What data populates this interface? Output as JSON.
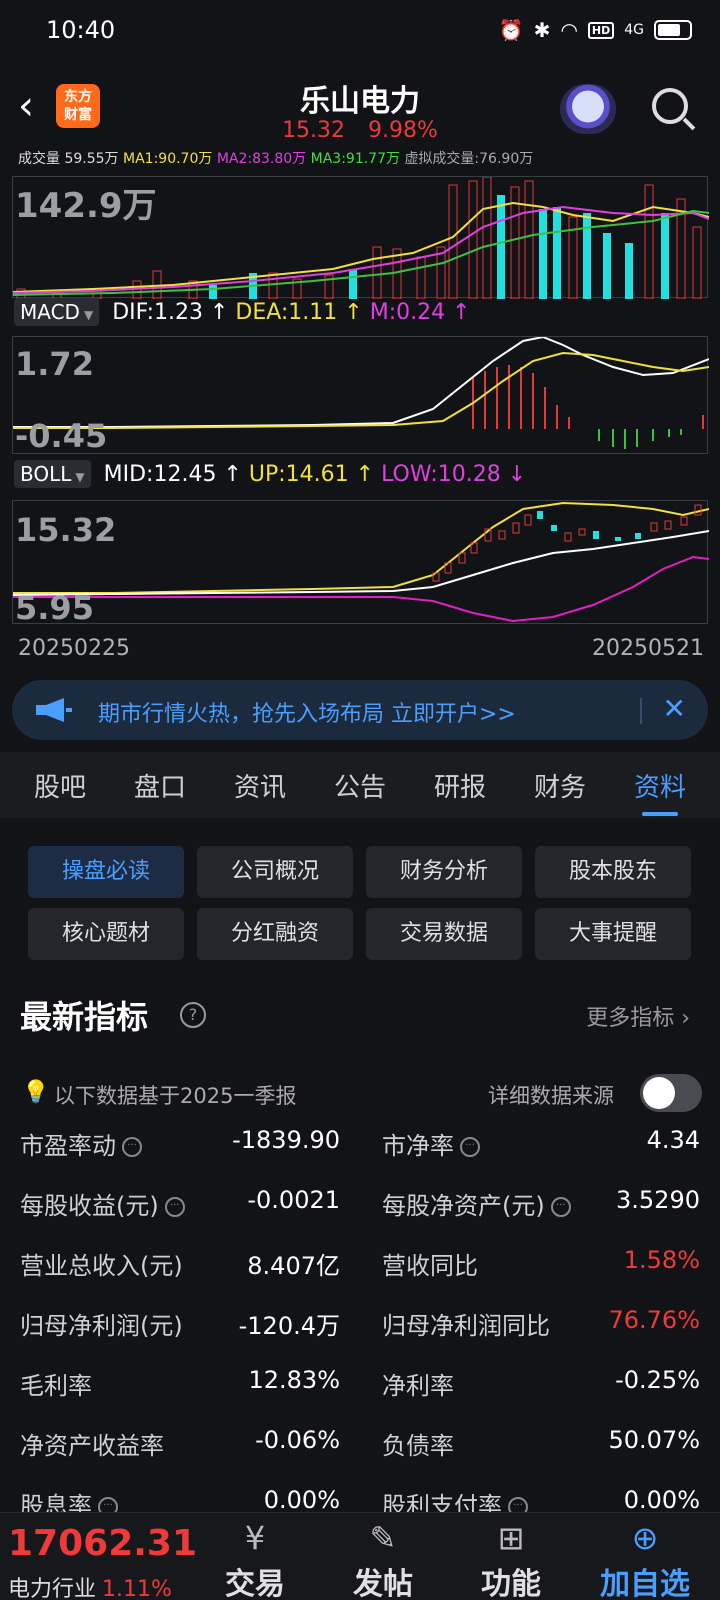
{
  "status_bar": {
    "time": "10:40",
    "network": "4G"
  },
  "header": {
    "back_icon": "chevron-left-icon",
    "logo_line1": "东方",
    "logo_line2": "财富",
    "title": "乐山电力",
    "price": "15.32",
    "change_pct": "9.98%",
    "colors": {
      "up": "#f03a3a",
      "accent": "#4a9eff"
    }
  },
  "volume_legend": {
    "label": "成交量",
    "vol": "59.55万",
    "ma1": "MA1:90.70万",
    "ma2": "MA2:83.80万",
    "ma3": "MA3:91.77万",
    "virtual": "虚拟成交量:76.90万",
    "axis_max": "142.9万"
  },
  "macd": {
    "tag": "MACD",
    "dif": "DIF:1.23",
    "dea": "DEA:1.11",
    "m": "M:0.24",
    "axis_top": "1.72",
    "axis_bottom": "-0.45"
  },
  "boll": {
    "tag": "BOLL",
    "mid": "MID:12.45",
    "up": "UP:14.61",
    "low": "LOW:10.28",
    "axis_top": "15.32",
    "axis_bottom": "5.95"
  },
  "dates": {
    "start": "20250225",
    "end": "20250521"
  },
  "banner": {
    "text": "期市行情火热，抢先入场布局 立即开户>>"
  },
  "tabs": [
    {
      "label": "股吧"
    },
    {
      "label": "盘口"
    },
    {
      "label": "资讯"
    },
    {
      "label": "公告"
    },
    {
      "label": "研报"
    },
    {
      "label": "财务"
    },
    {
      "label": "资料"
    }
  ],
  "chips": [
    {
      "label": "操盘必读"
    },
    {
      "label": "公司概况"
    },
    {
      "label": "财务分析"
    },
    {
      "label": "股本股东"
    },
    {
      "label": "核心题材"
    },
    {
      "label": "分红融资"
    },
    {
      "label": "交易数据"
    },
    {
      "label": "大事提醒"
    }
  ],
  "indicators": {
    "title": "最新指标",
    "more": "更多指标 ›",
    "note": "以下数据基于2025一季报",
    "source_label": "详细数据来源",
    "rows": [
      {
        "l1": "市盈率动",
        "v1": "-1839.90",
        "l2": "市净率",
        "v2": "4.34"
      },
      {
        "l1": "每股收益(元)",
        "v1": "-0.0021",
        "l2": "每股净资产(元)",
        "v2": "3.5290"
      },
      {
        "l1": "营业总收入(元)",
        "v1": "8.407亿",
        "l2": "营收同比",
        "v2": "1.58%"
      },
      {
        "l1": "归母净利润(元)",
        "v1": "-120.4万",
        "l2": "归母净利润同比",
        "v2": "76.76%"
      },
      {
        "l1": "毛利率",
        "v1": "12.83%",
        "l2": "净利率",
        "v2": "-0.25%"
      },
      {
        "l1": "净资产收益率",
        "v1": "-0.06%",
        "l2": "负债率",
        "v2": "50.07%"
      },
      {
        "l1": "股息率",
        "v1": "0.00%",
        "l2": "股利支付率",
        "v2": "0.00%"
      }
    ]
  },
  "bottom_bar": {
    "index_value": "17062.31",
    "industry": "电力行业",
    "industry_change": "1.11%",
    "buttons": [
      {
        "label": "交易",
        "icon": "yen-circle-icon"
      },
      {
        "label": "发帖",
        "icon": "edit-icon"
      },
      {
        "label": "功能",
        "icon": "grid-icon"
      },
      {
        "label": "加自选",
        "icon": "plus-circle-icon"
      }
    ]
  }
}
